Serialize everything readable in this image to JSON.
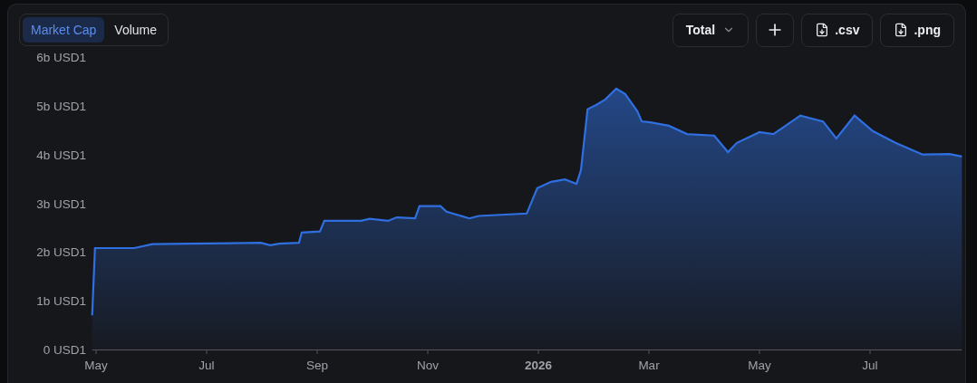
{
  "tabs": [
    {
      "label": "Market Cap",
      "selected": true
    },
    {
      "label": "Volume",
      "selected": false
    }
  ],
  "actions": [
    {
      "kind": "dropdown",
      "label": "Total"
    },
    {
      "kind": "add"
    },
    {
      "kind": "download",
      "label": ".csv"
    },
    {
      "kind": "download",
      "label": ".png"
    }
  ],
  "chart": {
    "y_axis_labels": [
      "6b USD1",
      "5b USD1",
      "4b USD1",
      "3b USD1",
      "2b USD1",
      "1b USD1",
      "0 USD1"
    ],
    "x_axis_labels": [
      {
        "label": "May",
        "kind": "month"
      },
      {
        "label": "Jul",
        "kind": "month"
      },
      {
        "label": "Sep",
        "kind": "month"
      },
      {
        "label": "Nov",
        "kind": "month"
      },
      {
        "label": "2026",
        "kind": "year"
      },
      {
        "label": "Mar",
        "kind": "month"
      },
      {
        "label": "May",
        "kind": "month"
      },
      {
        "label": "Jul",
        "kind": "month"
      }
    ]
  }
}
